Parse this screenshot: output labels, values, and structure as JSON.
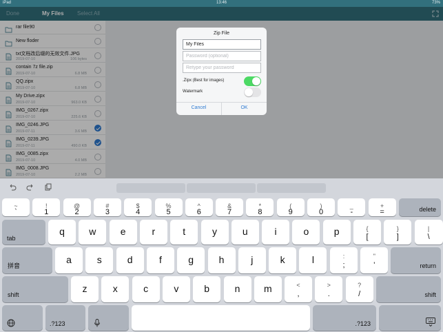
{
  "status_bar": {
    "device": "iPad",
    "time": "13:46",
    "battery": "73%"
  },
  "nav": {
    "done_label": "Done",
    "title": "My Files",
    "select_all_label": "Select All"
  },
  "files": [
    {
      "name": "rar file90",
      "date": "",
      "size": "",
      "type": "folder",
      "checked": false
    },
    {
      "name": "New floder",
      "date": "",
      "size": "",
      "type": "folder",
      "checked": false
    },
    {
      "name": "txt文档改后缀的无效文件.JPG",
      "date": "2019-07-10",
      "size": "106 bytes",
      "type": "file",
      "checked": false
    },
    {
      "name": "contain 7z file.zip",
      "date": "2019-07-10",
      "size": "6.8 MB",
      "type": "file",
      "checked": false
    },
    {
      "name": "QQ.zipx",
      "date": "2019-07-10",
      "size": "6.8 MB",
      "type": "file",
      "checked": false
    },
    {
      "name": "My Drive.zipx",
      "date": "2019-07-10",
      "size": "963.0 KB",
      "type": "file",
      "checked": false
    },
    {
      "name": "IMG_0267.zipx",
      "date": "2019-07-10",
      "size": "225.6 KB",
      "type": "file",
      "checked": false
    },
    {
      "name": "IMG_0246.JPG",
      "date": "2019-07-11",
      "size": "3.6 MB",
      "type": "file",
      "checked": true
    },
    {
      "name": "IMG_0239.JPG",
      "date": "2019-07-11",
      "size": "490.0 KB",
      "type": "file",
      "checked": true
    },
    {
      "name": "IMG_0085.zipx",
      "date": "2019-07-10",
      "size": "4.0 MB",
      "type": "file",
      "checked": false
    },
    {
      "name": "IMG_0008.JPG",
      "date": "2019-07-10",
      "size": "2.2 MB",
      "type": "file",
      "checked": false
    }
  ],
  "dialog": {
    "title": "Zip File",
    "filename_value": "My Files",
    "password_placeholder": "Password (optional)",
    "retype_placeholder": "Retype your password",
    "zipx_label": ".Zipx (Best for images)",
    "zipx_on": true,
    "watermark_label": "Watermark",
    "watermark_on": false,
    "cancel_label": "Cancel",
    "ok_label": "OK"
  },
  "keyboard": {
    "row1": [
      {
        "top": "~",
        "bottom": "`"
      },
      {
        "top": "!",
        "bottom": "1"
      },
      {
        "top": "@",
        "bottom": "2"
      },
      {
        "top": "#",
        "bottom": "3"
      },
      {
        "top": "$",
        "bottom": "4"
      },
      {
        "top": "%",
        "bottom": "5"
      },
      {
        "top": "^",
        "bottom": "6"
      },
      {
        "top": "&",
        "bottom": "7"
      },
      {
        "top": "*",
        "bottom": "8"
      },
      {
        "top": "(",
        "bottom": "9"
      },
      {
        "top": ")",
        "bottom": "0"
      },
      {
        "top": "_",
        "bottom": "-"
      },
      {
        "top": "+",
        "bottom": "="
      }
    ],
    "delete_label": "delete",
    "tab_label": "tab",
    "row2": [
      "q",
      "w",
      "e",
      "r",
      "t",
      "y",
      "u",
      "i",
      "o",
      "p"
    ],
    "row2_sym": [
      {
        "top": "{",
        "bottom": "["
      },
      {
        "top": "}",
        "bottom": "]"
      },
      {
        "top": "|",
        "bottom": "\\"
      }
    ],
    "pinyin_label": "拼音",
    "row3": [
      "a",
      "s",
      "d",
      "f",
      "g",
      "h",
      "j",
      "k",
      "l"
    ],
    "row3_sym": [
      {
        "top": ":",
        "bottom": ";"
      },
      {
        "top": "\"",
        "bottom": "'"
      }
    ],
    "return_label": "return",
    "shift_label": "shift",
    "row4": [
      "z",
      "x",
      "c",
      "v",
      "b",
      "n",
      "m"
    ],
    "row4_sym": [
      {
        "top": "<",
        "bottom": ","
      },
      {
        "top": ">",
        "bottom": "."
      },
      {
        "top": "?",
        "bottom": "/"
      }
    ],
    "numbers_label": ".?123"
  },
  "colors": {
    "nav": "#32707d",
    "accent": "#2f7bd2",
    "toggle_on": "#4cd964"
  }
}
